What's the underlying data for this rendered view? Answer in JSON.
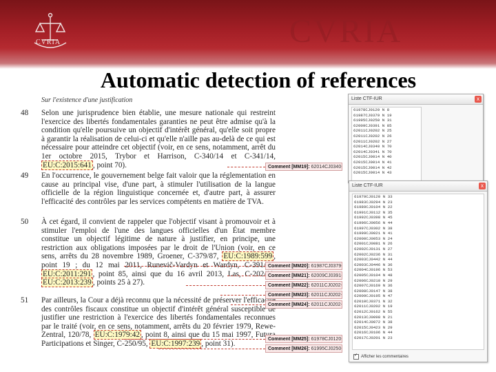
{
  "header": {
    "logo_text": "CVRIA",
    "watermark": "CVRIA",
    "title": "Automatic detection of references"
  },
  "document": {
    "heading": "Sur l'existence d'une justification",
    "paragraphs": [
      {
        "num": "48",
        "segments": [
          {
            "text": "Selon une jurisprudence bien établie, une mesure nationale qui restreint l'exercice des libertés fondamentales garanties ne peut être admise qu'à la condition qu'elle poursuive un objectif d'intérêt général, qu'elle soit propre à garantir la réalisation de celui-ci et qu'elle n'aille pas au-delà de ce qui est nécessaire pour atteindre cet objectif (voir, en ce sens, notamment, arrêt du 1er octobre 2015, Trybor et Harrison, C-340/14 et C-341/14, ",
            "hl": false
          },
          {
            "text": "EU:C:2015:641",
            "hl": true
          },
          {
            "text": ", point 70).",
            "hl": false
          }
        ]
      },
      {
        "num": "49",
        "segments": [
          {
            "text": "En l'occurrence, le gouvernement belge fait valoir que la réglementation en cause au principal vise, d'une part, à stimuler l'utilisation de la langue officielle de la région linguistique concernée et, d'autre part, à assurer l'efficacité des contrôles par les services compétents en matière de TVA.",
            "hl": false
          }
        ]
      },
      {
        "num": "50",
        "segments": [
          {
            "text": "À cet égard, il convient de rappeler que l'objectif visant à promouvoir et à stimuler l'emploi de l'une des langues officielles d'un État membre constitue un objectif légitime de nature à justifier, en principe, une restriction aux obligations imposées par le droit de l'Union (voir, en ce sens, arrêts du 28 novembre 1989, Groener, C-379/87, ",
            "hl": false
          },
          {
            "text": "EU:C:1989:599",
            "hl": true
          },
          {
            "text": ", point 19 ; du 12 mai 2011, Runevič-Vardyn et Wardyn, C-391/09, ",
            "hl": false
          },
          {
            "text": "EU:C:2011:291",
            "hl": true
          },
          {
            "text": ", point 85, ainsi que du 16 avril 2013, Las, C-202/11, ",
            "hl": false
          },
          {
            "text": "EU:C:2013:239",
            "hl": true
          },
          {
            "text": ", points 25 à 27).",
            "hl": false
          }
        ]
      },
      {
        "num": "51",
        "segments": [
          {
            "text": "Par ailleurs, la Cour a déjà reconnu que la nécessité de préserver l'efficacité des contrôles fiscaux constitue un objectif d'intérêt général susceptible de justifier une restriction à l'exercice des libertés fondamentales reconnues par le traité (voir, en ce sens, notamment, arrêts du 20 février 1979, Rewe-Zentral, 120/78, ",
            "hl": false
          },
          {
            "text": "EU:C:1979:42",
            "hl": true
          },
          {
            "text": ", point 8, ainsi que du 15 mai 1997, Futura Participations et Singer, C-250/95, ",
            "hl": false
          },
          {
            "text": "EU:C:1997:239",
            "hl": true
          },
          {
            "text": ", point 31).",
            "hl": false
          }
        ]
      }
    ],
    "comments": [
      {
        "label": "Comment [MM19]:",
        "ref": "62014CJ0340-70"
      },
      {
        "label": "Comment [MM20]:",
        "ref": "61987CJ0379-19"
      },
      {
        "label": "Comment [MM21]:",
        "ref": "62009CJ0391-85"
      },
      {
        "label": "Comment [MM22]:",
        "ref": "62011CJ0202-25"
      },
      {
        "label": "Comment [MM23]:",
        "ref": "62011CJ0202-26"
      },
      {
        "label": "Comment [MM24]:",
        "ref": "62011CJ0202-27"
      },
      {
        "label": "Comment [MM25]:",
        "ref": "61978CJ0120-8"
      },
      {
        "label": "Comment [MM26]:",
        "ref": "61995CJ0250-31"
      }
    ]
  },
  "window1": {
    "title": "Liste CTF-IUR",
    "close": "x",
    "rows": [
      "61978CJ0120 N 8",
      "61987CJ0379 N 19",
      "61995CJ0250 N 31",
      "62009CJ0391 N 85",
      "62011CJ0202 N 25",
      "62011CJ0202 N 26",
      "62011CJ0202 N 27",
      "62014CJ0340 N 70",
      "62014CJ0341 N 70",
      "62015CJ0014 N 40",
      "62015CJ0014 N 41",
      "62015CJ0014 N 42",
      "62015CJ0014 N 43"
    ]
  },
  "window2": {
    "title": "Liste CTF-IUR",
    "close": "x",
    "rows": [
      "61979CJ0120 N 33",
      "61983CJ0294 N 23",
      "61989CJ0104 N 22",
      "61991CJ0112 N 35",
      "61992CJ0398 N 45",
      "61996CJ0056 N 44",
      "61997CJ0302 N 38",
      "61999CJ0021 N 41",
      "62000CJ0053 N 24",
      "62001CJ0081 N 26",
      "62002CJ0131 N 27",
      "62002CJ0236 N 31",
      "62003CJ0442 N 44",
      "62003CJ0446 N 36",
      "62004CJ0196 N 53",
      "62005CJ0104 N 48",
      "62006CJ0210 N 29",
      "62007CJ0169 N 36",
      "62008CJ0147 N 38",
      "62009CJ0195 N 47",
      "62010CJ0371 N 32",
      "62011CJ0202 N 19",
      "62012CJ0162 N 55",
      "62013CJ0098 N 21",
      "62014CJ0072 N 38",
      "62015CJ0423 N 29",
      "62016CJ0106 N 44",
      "62017CJ0201 N 23"
    ],
    "footer": "Afficher les commentaires"
  }
}
